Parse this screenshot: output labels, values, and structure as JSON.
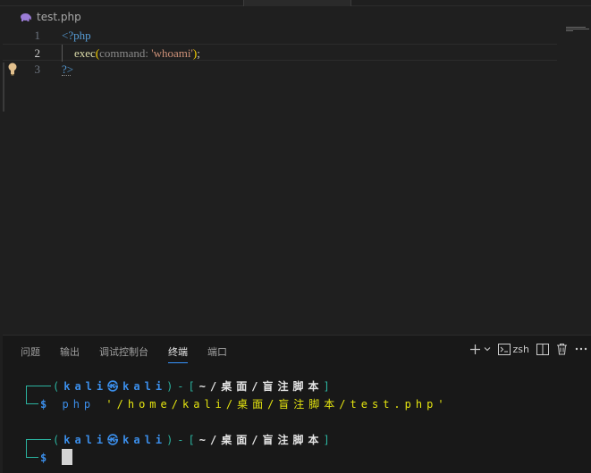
{
  "tab": {
    "file_name": "test.php"
  },
  "editor": {
    "lines": [
      {
        "number": "1",
        "text": "<?php"
      },
      {
        "number": "2",
        "fn": "exec",
        "open": "(",
        "param": "command:",
        "arg": "'whoami'",
        "close": ")",
        "semi": ";"
      },
      {
        "number": "3",
        "text": "?>"
      }
    ]
  },
  "panel": {
    "tabs": [
      "问题",
      "输出",
      "调试控制台",
      "终端",
      "端口"
    ],
    "active_tab": "终端",
    "shell_label": "zsh"
  },
  "terminal": {
    "prompt_user": "kali",
    "prompt_at": "㉿",
    "prompt_host": "kali",
    "prompt_dash": "-",
    "prompt_dir": "~/桌面/盲注脚本",
    "prompt_symbol": "$",
    "open_paren": "(",
    "close_paren": ")",
    "open_bracket": "[",
    "close_bracket": "]",
    "cmd_name": "php",
    "cmd_arg": "'/home/kali/桌面/盲注脚本/test.php'"
  },
  "colors": {
    "accent": "#3794ff",
    "terminal_green": "#2bb4a0",
    "terminal_blue": "#3b8eea",
    "terminal_yellow": "#e5e510"
  }
}
